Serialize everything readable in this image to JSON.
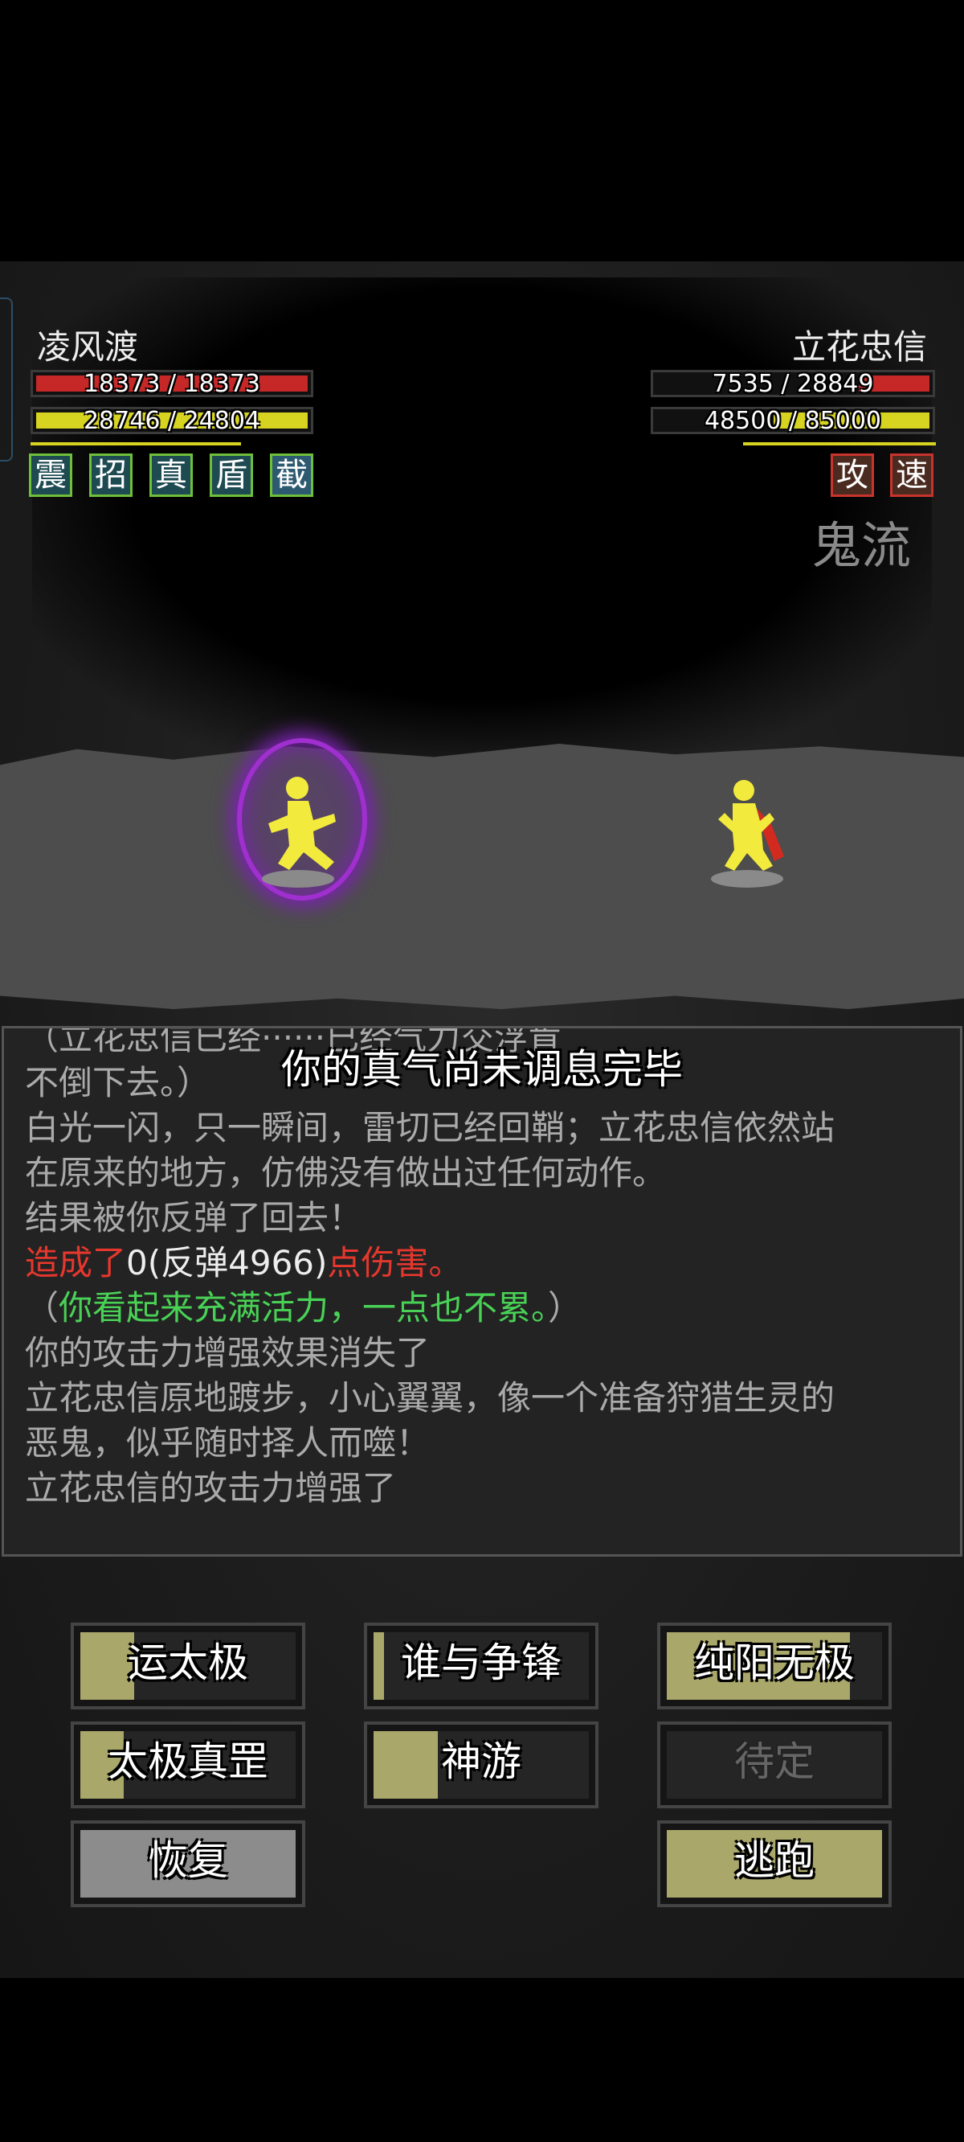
{
  "player": {
    "name": "凌风渡",
    "hp": "18373 / 18373",
    "mp": "28746 / 24804",
    "hp_fraction": 1.0,
    "mp_fraction": 1.0,
    "buffs": [
      "震",
      "招",
      "真",
      "盾",
      "截"
    ]
  },
  "enemy": {
    "name": "立花忠信",
    "hp": "7535 / 28849",
    "mp": "48500 / 85000",
    "hp_fraction": 0.26,
    "mp_fraction": 0.57,
    "buffs": [
      "攻",
      "速"
    ],
    "status": "鬼流"
  },
  "toast": "你的真气尚未调息完毕",
  "log": {
    "top_fragment": "（立花忠信已经······已经气力交浮肯",
    "line1": "不倒下去。）",
    "line2": "白光一闪，只一瞬间，雷切已经回鞘；立花忠信依然站",
    "line3": "在原来的地方，仿佛没有做出过任何动作。",
    "line4": "结果被你反弹了回去！",
    "line5a": "造成了",
    "line5b": "0(反弹4966)",
    "line5c": "点伤害。",
    "line6a": "（",
    "line6b": "你看起来充满活力，一点也不累。",
    "line6c": "）",
    "line7": "你的攻击力增强效果消失了",
    "line8": "立花忠信原地踱步，小心翼翼，像一个准备狩猎生灵的",
    "line9": "恶鬼，似乎随时择人而噬！",
    "line10": "立花忠信的攻击力增强了"
  },
  "skills": [
    {
      "label": "运太极",
      "progress": 0.25
    },
    {
      "label": "谁与争锋",
      "progress": 0.05
    },
    {
      "label": "纯阳无极",
      "progress": 0.85
    },
    {
      "label": "太极真罡",
      "progress": 0.2
    },
    {
      "label": "神游",
      "progress": 0.3
    },
    {
      "label": "待定",
      "progress": 0
    },
    {
      "label": "恢复",
      "progress": 1.0
    },
    {
      "label": "逃跑",
      "progress": 1.0
    }
  ]
}
